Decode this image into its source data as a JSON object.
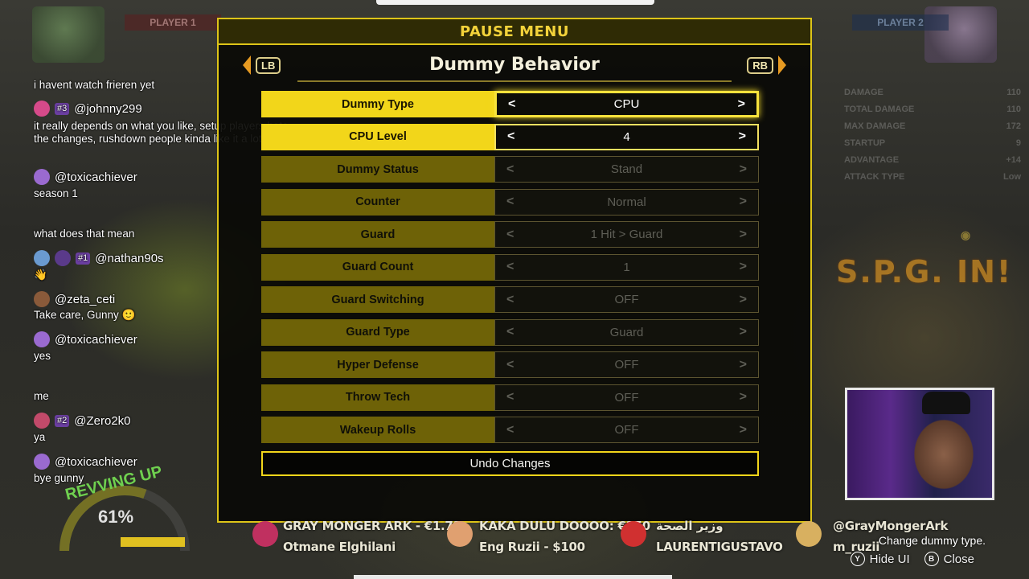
{
  "menu": {
    "header": "PAUSE MENU",
    "title": "Dummy Behavior",
    "prev_button": "LB",
    "next_button": "RB",
    "rows": [
      {
        "label": "Dummy Type",
        "value": "CPU",
        "state": "selected"
      },
      {
        "label": "CPU Level",
        "value": "4",
        "state": "active"
      },
      {
        "label": "Dummy Status",
        "value": "Stand",
        "state": "disabled"
      },
      {
        "label": "Counter",
        "value": "Normal",
        "state": "disabled"
      },
      {
        "label": "Guard",
        "value": "1 Hit > Guard",
        "state": "disabled"
      },
      {
        "label": "Guard Count",
        "value": "1",
        "state": "disabled"
      },
      {
        "label": "Guard Switching",
        "value": "OFF",
        "state": "disabled"
      },
      {
        "label": "Guard Type",
        "value": "Guard",
        "state": "disabled"
      },
      {
        "label": "Hyper Defense",
        "value": "OFF",
        "state": "disabled"
      },
      {
        "label": "Throw Tech",
        "value": "OFF",
        "state": "disabled"
      },
      {
        "label": "Wakeup Rolls",
        "value": "OFF",
        "state": "disabled"
      }
    ],
    "arrow_left": "<",
    "arrow_right": ">",
    "undo": "Undo Changes"
  },
  "hud": {
    "player1": "PLAYER 1",
    "player2": "PLAYER 2",
    "spg": "S.P.G. IN!",
    "gauge_label": "REVVING UP",
    "gauge_percent": "61%",
    "stats": [
      {
        "name": "DAMAGE",
        "value": "110"
      },
      {
        "name": "TOTAL DAMAGE",
        "value": "110"
      },
      {
        "name": "MAX DAMAGE",
        "value": "172"
      },
      {
        "name": "STARTUP",
        "value": "9"
      },
      {
        "name": "ADVANTAGE",
        "value": "+14"
      },
      {
        "name": "ATTACK TYPE",
        "value": "Low"
      }
    ]
  },
  "chat": {
    "messages": [
      {
        "user": "",
        "badge": "",
        "text": "i havent watch frieren yet"
      },
      {
        "user": "@johnny299",
        "badge": "#3",
        "text": "it really depends on what you like, setup players hate the changes, rushdown people kinda like it a lot"
      },
      {
        "user": "@toxicachiever",
        "badge": "",
        "text": "season 1"
      },
      {
        "user": "",
        "badge": "",
        "text": "what does that mean"
      },
      {
        "user": "@nathan90s",
        "badge": "#1",
        "text": "👋"
      },
      {
        "user": "@zeta_ceti",
        "badge": "",
        "text": "Take care, Gunny 🙂"
      },
      {
        "user": "@toxicachiever",
        "badge": "",
        "text": "yes"
      },
      {
        "user": "",
        "badge": "",
        "text": "me"
      },
      {
        "user": "@Zero2k0",
        "badge": "#2",
        "text": "ya"
      },
      {
        "user": "@toxicachiever",
        "badge": "",
        "text": "bye gunny"
      }
    ],
    "colors": {
      "johnny": "#d64a8a",
      "toxic": "#9a6ad0",
      "zeta": "#8a5a3a",
      "zero": "#c24a6a",
      "nathan": "#6a9ad0"
    }
  },
  "donations": [
    {
      "line1": "GRAY MONGER ARK - €1.71",
      "line2": "Otmane Elghilani"
    },
    {
      "line1": "KAKA DULU DOOOO: €150",
      "line2": "Eng Ruzii - $100"
    },
    {
      "line1": "وزير الصحة",
      "line2": "LAURENTIGUSTAVO"
    },
    {
      "line1": "@GrayMongerArk",
      "line2": "m_ruzii"
    }
  ],
  "footer": {
    "hint": "Change dummy type.",
    "hide_ui_key": "Y",
    "hide_ui": "Hide UI",
    "close_key": "B",
    "close": "Close"
  }
}
